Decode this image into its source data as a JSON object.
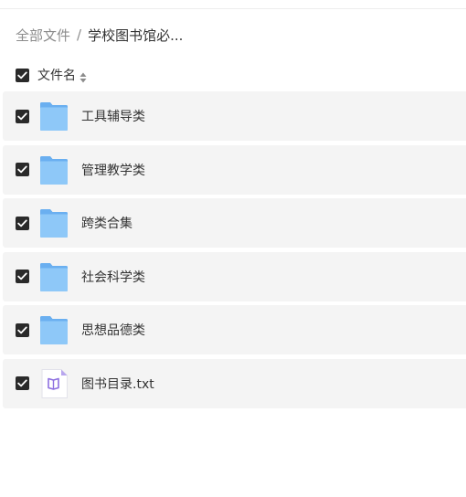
{
  "breadcrumb": {
    "root": "全部文件",
    "separator": "/",
    "current": "学校图书馆必..."
  },
  "header": {
    "column_label": "文件名",
    "select_all_checked": true,
    "sort_icon": "sort-icon"
  },
  "files": [
    {
      "name": "工具辅导类",
      "type": "folder",
      "checked": true,
      "icon": "folder-icon"
    },
    {
      "name": "管理教学类",
      "type": "folder",
      "checked": true,
      "icon": "folder-icon"
    },
    {
      "name": "跨类合集",
      "type": "folder",
      "checked": true,
      "icon": "folder-icon"
    },
    {
      "name": "社会科学类",
      "type": "folder",
      "checked": true,
      "icon": "folder-icon"
    },
    {
      "name": "思想品德类",
      "type": "folder",
      "checked": true,
      "icon": "folder-icon"
    },
    {
      "name": "图书目录.txt",
      "type": "txt",
      "checked": true,
      "icon": "txt-file-icon"
    }
  ],
  "colors": {
    "checkbox": "#2a2a2a",
    "row_background": "#f4f4f4",
    "folder_blue": "#7bbef5",
    "txt_accent": "#8d6fe0"
  }
}
